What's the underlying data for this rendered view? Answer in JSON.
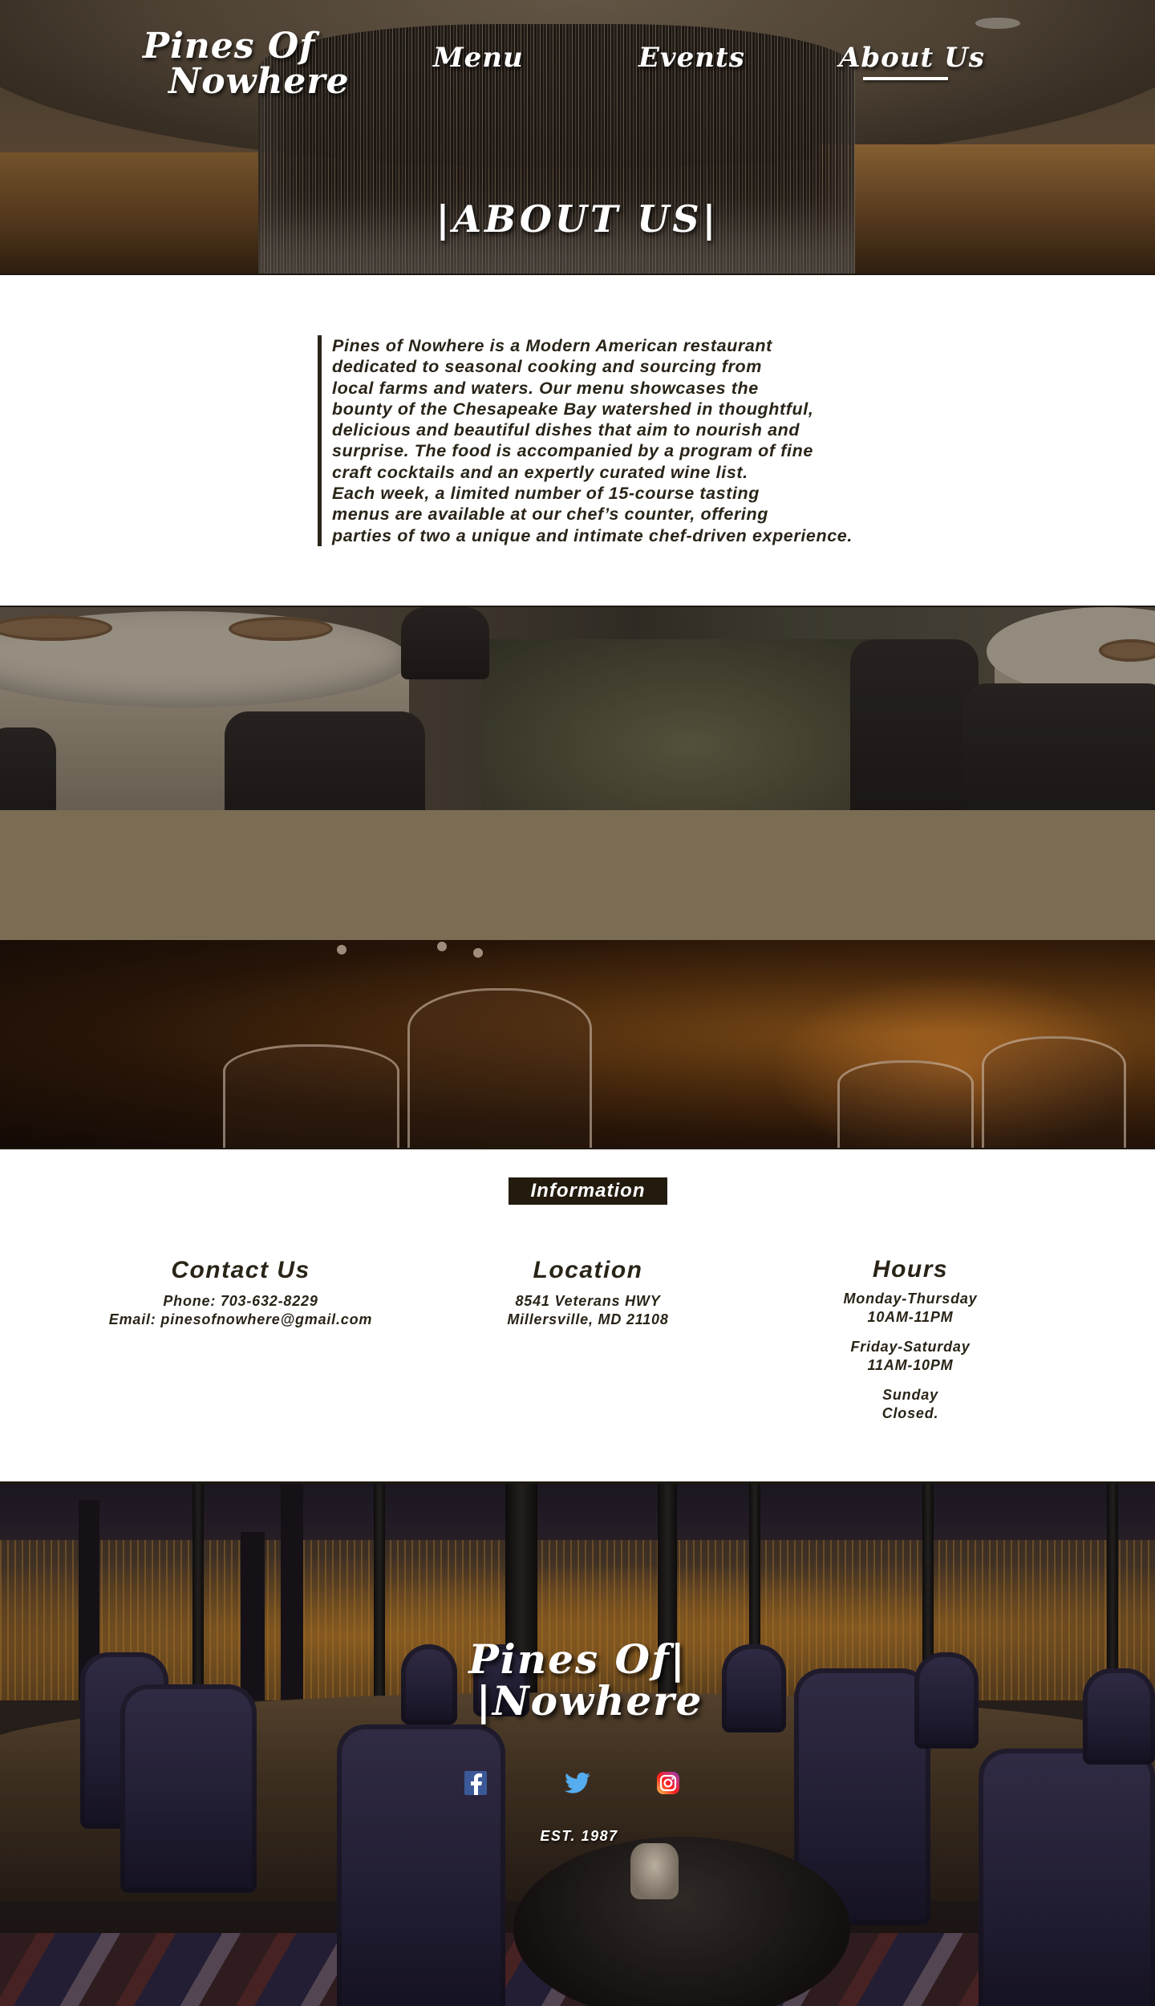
{
  "site": {
    "logo_line1": "Pines Of",
    "logo_line2": "Nowhere"
  },
  "nav": {
    "items": [
      {
        "label": "Menu"
      },
      {
        "label": "Events"
      },
      {
        "label": "About Us",
        "active": true
      }
    ]
  },
  "hero": {
    "title": "|ABOUT US|"
  },
  "about": {
    "text": "Pines of Nowhere is a Modern American restaurant\ndedicated to seasonal cooking and sourcing from\nlocal farms and waters. Our menu showcases the\nbounty of the Chesapeake Bay watershed in thoughtful,\ndelicious and beautiful dishes that aim to nourish and\nsurprise. The food is accompanied by a program of fine\ncraft cocktails and an expertly curated wine list.\nEach week, a limited number of 15-course tasting\nmenus are available at our chef’s counter, offering\nparties of two a unique and intimate chef-driven experience."
  },
  "info": {
    "tag": "Information",
    "contact": {
      "heading": "Contact Us",
      "phone": "Phone: 703-632-8229",
      "email": "Email: pinesofnowhere@gmail.com"
    },
    "location": {
      "heading": "Location",
      "street": "8541 Veterans HWY",
      "city": "Millersville, MD 21108"
    },
    "hours": {
      "heading": "Hours",
      "rows": [
        {
          "days": "Monday-Thursday",
          "time": "10AM-11PM"
        },
        {
          "days": "Friday-Saturday",
          "time": "11AM-10PM"
        },
        {
          "days": "Sunday",
          "time": "Closed."
        }
      ]
    }
  },
  "footer": {
    "logo_line1": "Pines Of|",
    "logo_line2": "|Nowhere",
    "social": [
      {
        "icon": "facebook-icon",
        "color": "#3b5998"
      },
      {
        "icon": "twitter-icon",
        "color": "#55acee"
      },
      {
        "icon": "instagram-icon",
        "color": "#d6249f"
      }
    ],
    "est": "EST. 1987"
  },
  "colors": {
    "dark_brown": "#231b0e",
    "band_taupe": "#7b6c54",
    "text": "#2a2418"
  }
}
